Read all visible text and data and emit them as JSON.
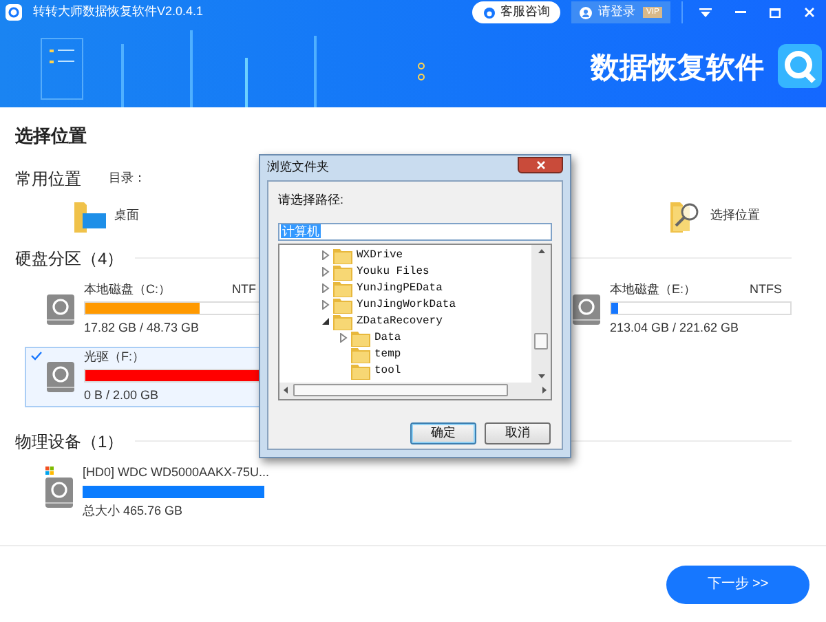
{
  "window": {
    "title": "转转大师数据恢复软件V2.0.4.1",
    "support_button": "客服咨询",
    "login_button": "请登录",
    "vip_badge": "VIP"
  },
  "banner": {
    "title": "数据恢复软件"
  },
  "page_title": "选择位置",
  "common": {
    "heading": "常用位置",
    "directory_label": "目录：",
    "items": [
      {
        "label": "桌面",
        "kind": "desktop"
      },
      {
        "label": "选择位置",
        "kind": "browse"
      }
    ]
  },
  "partitions": {
    "heading": "硬盘分区（4）",
    "rows": [
      {
        "items": [
          {
            "name": "本地磁盘（C:）",
            "fs": "NTF",
            "usage": "17.82 GB / 48.73 GB",
            "level": 0.64,
            "color": "#ff9900",
            "selected": false
          },
          {
            "name": "本地磁盘（E:）",
            "fs": "NTFS",
            "usage": "213.04 GB / 221.62 GB",
            "level": 0.04,
            "color": "#1677ff",
            "selected": false
          }
        ]
      },
      {
        "items": [
          {
            "name": "光驱（F:）",
            "usage": "0 B / 2.00 GB",
            "level": 1,
            "color": "#ff0000",
            "selected": true
          }
        ]
      }
    ]
  },
  "devices": {
    "heading": "物理设备（1）",
    "items": [
      {
        "name": "[HD0] WDC WD5000AAKX-75U...",
        "size": "总大小 465.76 GB",
        "level": 1,
        "color": "#0a7cff"
      }
    ]
  },
  "next_button": "下一步 >>",
  "dialog": {
    "title": "浏览文件夹",
    "prompt": "请选择路径:",
    "path_value": "计算机",
    "value_selected": true,
    "tree": [
      {
        "label": "WXDrive",
        "expandable": true,
        "expanded": false
      },
      {
        "label": "Youku Files",
        "expandable": true,
        "expanded": false
      },
      {
        "label": "YunJingPEData",
        "expandable": true,
        "expanded": false
      },
      {
        "label": "YunJingWorkData",
        "expandable": true,
        "expanded": false
      },
      {
        "label": "ZDataRecovery",
        "expandable": true,
        "expanded": true,
        "children": [
          {
            "label": "Data",
            "expandable": true,
            "expanded": false
          },
          {
            "label": "temp",
            "expandable": false,
            "expanded": false
          },
          {
            "label": "tool",
            "expandable": false,
            "expanded": false
          }
        ]
      }
    ],
    "buttons": [
      {
        "label": "确定",
        "default": true
      },
      {
        "label": "取消",
        "default": false
      }
    ]
  }
}
